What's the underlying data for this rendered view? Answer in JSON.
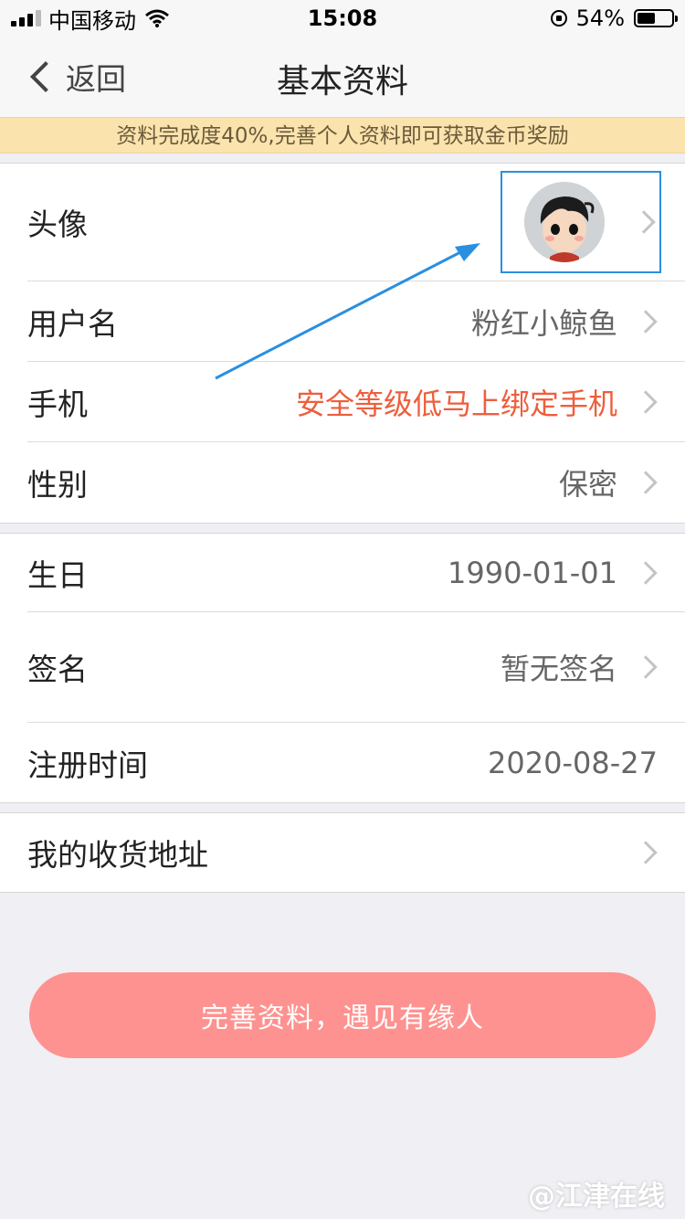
{
  "status_bar": {
    "carrier": "中国移动",
    "time": "15:08",
    "battery": "54%",
    "battery_level": 0.54
  },
  "nav": {
    "back_label": "返回",
    "title": "基本资料"
  },
  "banner": {
    "text": "资料完成度40%,完善个人资料即可获取金币奖励"
  },
  "profile": {
    "avatar_label": "头像",
    "username_label": "用户名",
    "username_value": "粉红小鲸鱼",
    "phone_label": "手机",
    "phone_value": "安全等级低马上绑定手机",
    "gender_label": "性别",
    "gender_value": "保密"
  },
  "details": {
    "birthday_label": "生日",
    "birthday_value": "1990-01-01",
    "signature_label": "签名",
    "signature_value": "暂无签名",
    "register_label": "注册时间",
    "register_value": "2020-08-27"
  },
  "address": {
    "label": "我的收货地址"
  },
  "cta": {
    "label": "完善资料，遇见有缘人"
  },
  "watermark": "@江津在线",
  "colors": {
    "warn": "#ee5e3c",
    "cta": "#fe9290",
    "highlight": "#2a8fe0",
    "banner": "#fbe3ad"
  }
}
